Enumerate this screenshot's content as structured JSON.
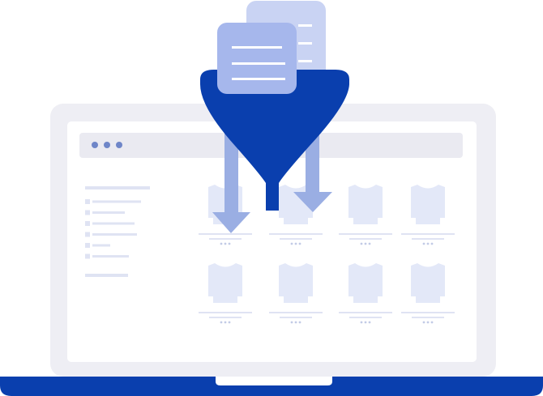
{
  "colors": {
    "laptop_frame": "#eeeef4",
    "screen_bg": "#ffffff",
    "browser_bar": "#eaeaf1",
    "browser_dots": "#6f86c8",
    "sidebar_line": "#dfe3f3",
    "sidebar_checkbox": "#dfe3f3",
    "product_shirt": "#e3e8f8",
    "product_line": "#dfe3f3",
    "product_dots": "#c3cbe6",
    "laptop_base": "#0a3fae",
    "laptop_notch": "#ffffff",
    "funnel": "#0a3fae",
    "arrows": "#9aaee3",
    "document_front": "#a6b7ec",
    "document_back": "#c9d3f3",
    "document_lines": "#ffffff"
  },
  "icons": {
    "funnel": "funnel-icon",
    "document": "document-icon",
    "arrow": "arrow-down-icon",
    "product": "sweater-icon"
  },
  "sidebar": {
    "filter_count": 6
  },
  "products": {
    "rows": 2,
    "columns": 4,
    "items": [
      {
        "id": 1
      },
      {
        "id": 2
      },
      {
        "id": 3
      },
      {
        "id": 4
      },
      {
        "id": 5
      },
      {
        "id": 6
      },
      {
        "id": 7
      },
      {
        "id": 8
      }
    ]
  }
}
